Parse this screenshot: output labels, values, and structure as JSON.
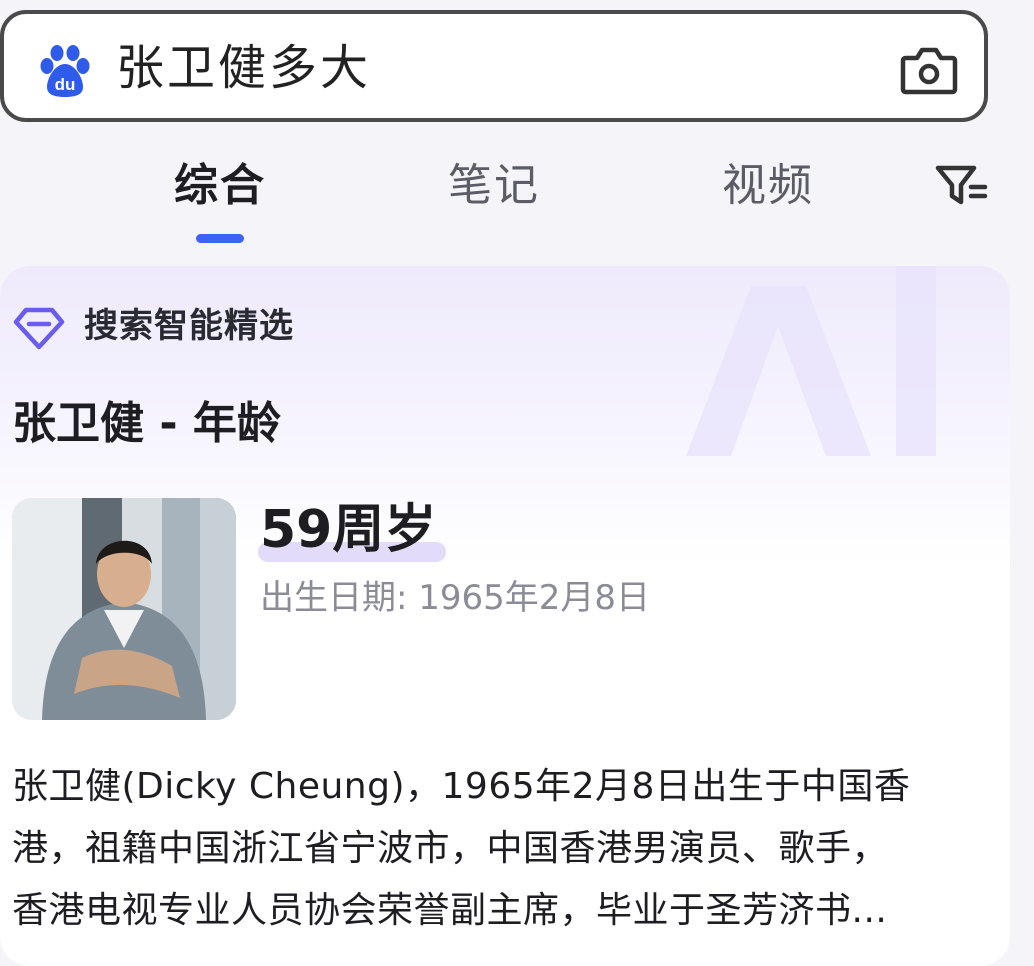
{
  "search": {
    "query": "张卫健多大"
  },
  "tabs": [
    {
      "label": "综合",
      "active": true
    },
    {
      "label": "笔记",
      "active": false
    },
    {
      "label": "视频",
      "active": false
    }
  ],
  "ai_card": {
    "label": "搜索智能精选",
    "title": "张卫健 - 年龄",
    "age": "59周岁",
    "birth_date": "出生日期: 1965年2月8日",
    "summary_lines": [
      "张卫健(Dicky Cheung)，1965年2月8日出生于中国香",
      "港，祖籍中国浙江省宁波市，中国香港男演员、歌手，",
      "香港电视专业人员协会荣誉副主席，毕业于圣芳济书..."
    ]
  },
  "colors": {
    "accent": "#3e63f2",
    "brand_blue": "#2f5bea",
    "ai_purple": "#6a5cf0",
    "highlight": "#e3dbfa"
  },
  "icons": {
    "logo": "baidu-paw-logo",
    "camera": "camera-icon",
    "filter": "filter-icon",
    "ai": "diamond-icon"
  }
}
